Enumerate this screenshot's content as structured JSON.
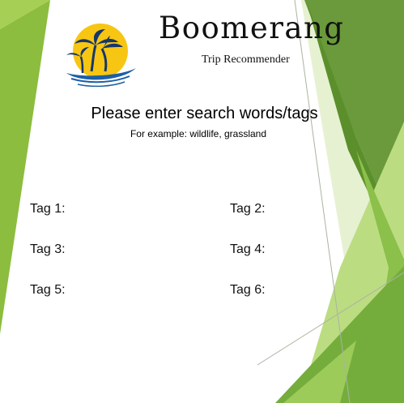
{
  "brand": {
    "title": "Boomerang",
    "subtitle": "Trip Recommender"
  },
  "search": {
    "heading": "Please enter search words/tags",
    "example": "For example: wildlife, grassland"
  },
  "tags": [
    {
      "label": "Tag 1:"
    },
    {
      "label": "Tag 2:"
    },
    {
      "label": "Tag 3:"
    },
    {
      "label": "Tag 4:"
    },
    {
      "label": "Tag 5:"
    },
    {
      "label": "Tag 6:"
    }
  ],
  "colors": {
    "green_dark": "#5f9a31",
    "green_mid": "#7ab648",
    "green_light": "#a7cf62",
    "green_pale": "#d9ebbd",
    "logo_yellow": "#f7c613",
    "logo_blue": "#1c5fa6"
  }
}
